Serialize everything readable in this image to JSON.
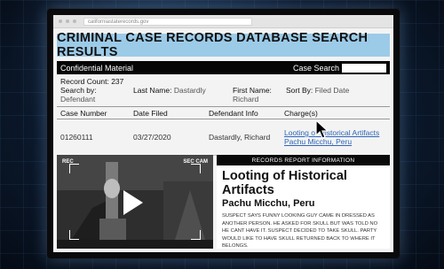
{
  "browser": {
    "url": "californiastaterecords.gov"
  },
  "page": {
    "title": "CRIMINAL CASE RECORDS DATABASE SEARCH RESULTS"
  },
  "toolbar": {
    "confidential": "Confidential Material",
    "search_label": "Case Search"
  },
  "meta": {
    "record_count_label": "Record Count:",
    "record_count": "237",
    "search_by_label": "Search by:",
    "search_by": "Defendant",
    "last_name_label": "Last Name:",
    "last_name": "Dastardly",
    "first_name_label": "First Name:",
    "first_name": "Richard",
    "sort_by_label": "Sort By:",
    "sort_by": "Filed Date"
  },
  "table": {
    "headers": [
      "Case Number",
      "Date Filed",
      "Defendant Info",
      "Charge(s)"
    ],
    "rows": [
      {
        "case_number": "01260111",
        "date_filed": "03/27/2020",
        "defendant": "Dastardly, Richard",
        "charge_line1": "Looting of Historical Artifacts",
        "charge_line2": "Pachu Micchu, Peru"
      }
    ]
  },
  "video": {
    "rec": "REC",
    "sec_cam": "SEC CAM",
    "icon": "play-icon"
  },
  "report": {
    "header": "RECORDS REPORT INFORMATION",
    "title": "Looting of Historical Artifacts",
    "subtitle": "Pachu Micchu, Peru",
    "body": "SUSPECT SAYS FUNNY LOOKING GUY CAME IN DRESSED AS ANOTHER PERSON. HE ASKED FOR SKULL BUT WAS TOLD NO HE CANT HAVE IT. SUSPECT DECIDED TO TAKE SKULL. PARTY WOULD LIKE TO HAVE SKULL RETURNED BACK TO WHERE IT BELONGS."
  },
  "colors": {
    "title_bar": "#9ccbe8",
    "link": "#2f66b7",
    "black_bar": "#050505"
  }
}
